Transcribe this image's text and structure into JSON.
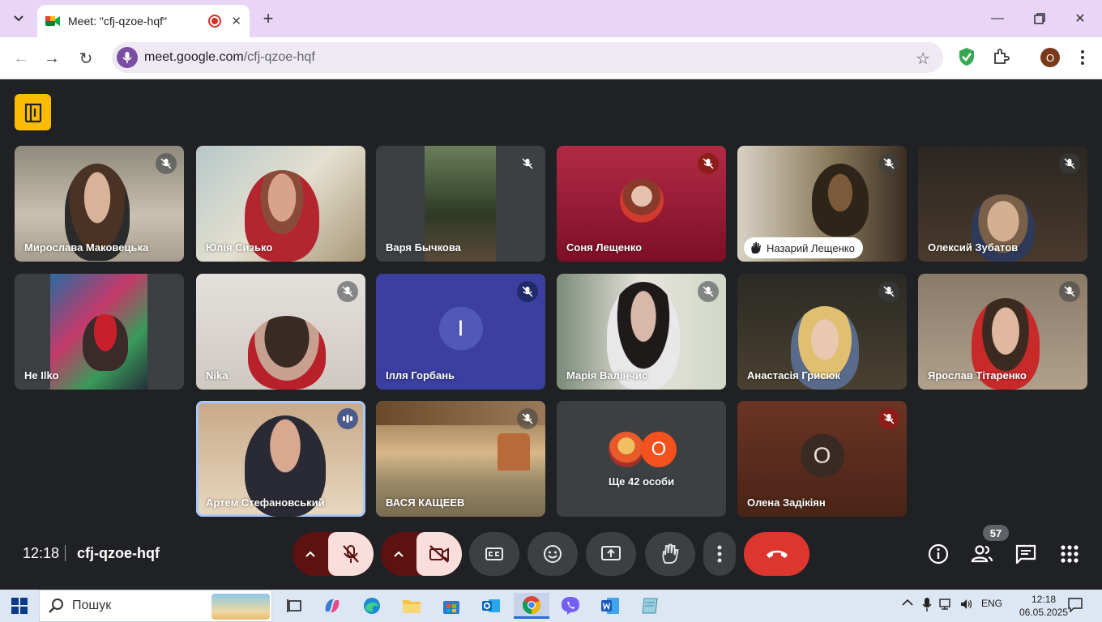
{
  "browser": {
    "tab_title": "Meet: \"cfj-qzoe-hqf\"",
    "url_host": "meet.google.com",
    "url_path": "/cfj-qzoe-hqf",
    "profile_initial": "O"
  },
  "tiles": [
    {
      "name": "Мирослава Маковецька",
      "muted": true
    },
    {
      "name": "Юлія Сизько",
      "muted": false
    },
    {
      "name": "Варя Бычкова",
      "muted": true
    },
    {
      "name": "Соня Лещенко",
      "muted": true
    },
    {
      "name": "Назарий Лещенко",
      "muted": true,
      "hand_raised": true
    },
    {
      "name": "Олексий Зубатов",
      "muted": true
    },
    {
      "name": "Не Ilko",
      "muted": false
    },
    {
      "name": "Nika",
      "muted": true
    },
    {
      "name": "Ілля Горбань",
      "muted": true,
      "avatar_letter": "I"
    },
    {
      "name": "Марія Валінчис",
      "muted": true
    },
    {
      "name": "Анастасія Грисюк",
      "muted": true
    },
    {
      "name": "Ярослав Тітаренко",
      "muted": true
    },
    {
      "name": "Артем Стефановський",
      "speaking": true
    },
    {
      "name": "ВАСЯ КАЩЕЕВ",
      "muted": true
    },
    {
      "name": "Ще 42 особи",
      "avatar_letter": "O"
    },
    {
      "name": "Олена Задікіян",
      "muted": true,
      "avatar_letter": "O"
    }
  ],
  "meeting": {
    "time": "12:18",
    "code": "cfj-qzoe-hqf",
    "participants_count": "57"
  },
  "taskbar": {
    "search_label": "Пошук",
    "language": "ENG",
    "time": "12:18",
    "date": "06.05.2025"
  },
  "colors": {
    "meet_bg": "#202124",
    "hangup": "#dc362e",
    "muted_control": "#f9dedc",
    "speaking_outline": "#a8c7fa"
  }
}
